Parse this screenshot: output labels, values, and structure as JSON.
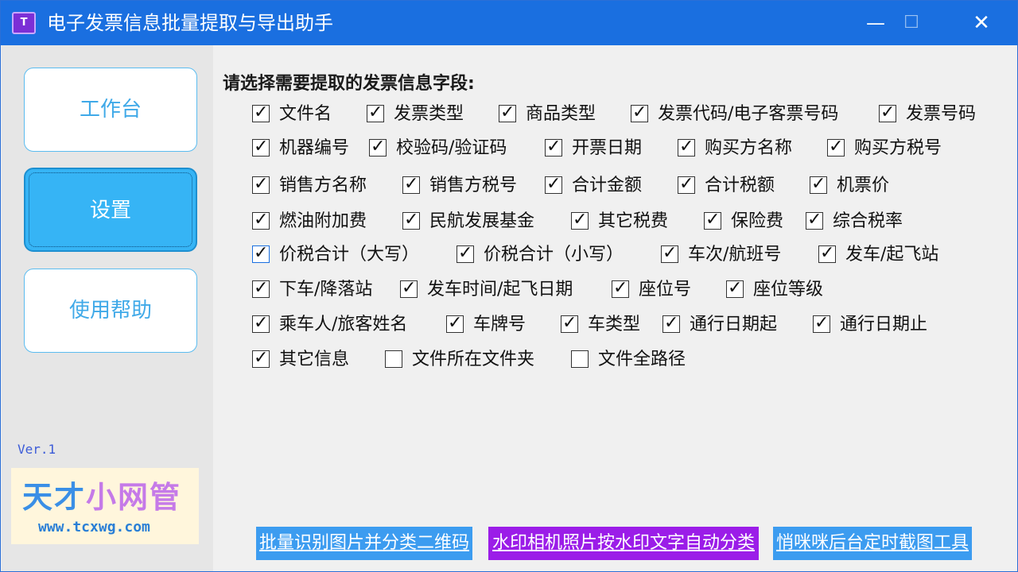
{
  "window": {
    "title": "电子发票信息批量提取与导出助手",
    "icon_text": "T",
    "controls": {
      "minimize": "—",
      "maximize": "☐",
      "close": "✕"
    }
  },
  "sidebar": {
    "items": [
      {
        "label": "工作台"
      },
      {
        "label": "设置"
      },
      {
        "label": "使用帮助"
      }
    ],
    "version": "Ver.1",
    "logo": {
      "part1": "天才",
      "part2": "小网管",
      "url": "www.tcxwg.com"
    }
  },
  "main": {
    "prompt": "请选择需要提取的发票信息字段:",
    "checkboxes": [
      {
        "label": "文件名",
        "checked": true
      },
      {
        "label": "发票类型",
        "checked": true
      },
      {
        "label": "商品类型",
        "checked": true
      },
      {
        "label": "发票代码/电子客票号码",
        "checked": true
      },
      {
        "label": "发票号码",
        "checked": true
      },
      {
        "label": "机器编号",
        "checked": true
      },
      {
        "label": "校验码/验证码",
        "checked": true
      },
      {
        "label": "开票日期",
        "checked": true
      },
      {
        "label": "购买方名称",
        "checked": true
      },
      {
        "label": "购买方税号",
        "checked": true
      },
      {
        "label": "销售方名称",
        "checked": true
      },
      {
        "label": "销售方税号",
        "checked": true
      },
      {
        "label": "合计金额",
        "checked": true
      },
      {
        "label": "合计税额",
        "checked": true
      },
      {
        "label": "机票价",
        "checked": true
      },
      {
        "label": "燃油附加费",
        "checked": true
      },
      {
        "label": "民航发展基金",
        "checked": true
      },
      {
        "label": "其它税费",
        "checked": true
      },
      {
        "label": "保险费",
        "checked": true
      },
      {
        "label": "综合税率",
        "checked": true
      },
      {
        "label": "价税合计（大写）",
        "checked": true
      },
      {
        "label": "价税合计（小写）",
        "checked": true
      },
      {
        "label": "车次/航班号",
        "checked": true
      },
      {
        "label": "发车/起飞站",
        "checked": true
      },
      {
        "label": "下车/降落站",
        "checked": true
      },
      {
        "label": "发车时间/起飞日期",
        "checked": true
      },
      {
        "label": "座位号",
        "checked": true
      },
      {
        "label": "座位等级",
        "checked": true
      },
      {
        "label": "乘车人/旅客姓名",
        "checked": true
      },
      {
        "label": "车牌号",
        "checked": true
      },
      {
        "label": "车类型",
        "checked": true
      },
      {
        "label": "通行日期起",
        "checked": true
      },
      {
        "label": "通行日期止",
        "checked": true
      },
      {
        "label": "其它信息",
        "checked": true
      },
      {
        "label": "文件所在文件夹",
        "checked": false
      },
      {
        "label": "文件全路径",
        "checked": false
      }
    ],
    "links": [
      {
        "label": "批量识别图片并分类二维码",
        "color": "#3c9cf0"
      },
      {
        "label": "水印相机照片按水印文字自动分类",
        "color": "#9b1de8"
      },
      {
        "label": "悄咪咪后台定时截图工具",
        "color": "#3c9cf0"
      }
    ]
  },
  "colors": {
    "titlebar": "#1a6fe0",
    "accent": "#36b4f5",
    "nav_text": "#3fa9e8"
  }
}
